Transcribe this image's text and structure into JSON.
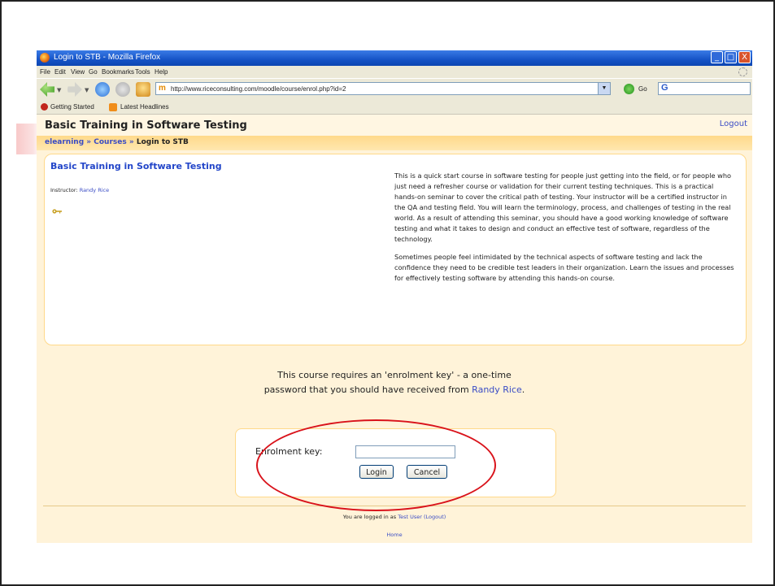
{
  "window": {
    "title": "Login to STB - Mozilla Firefox",
    "controls": {
      "minimize": "_",
      "maximize": "□",
      "close": "X"
    }
  },
  "menu": [
    "File",
    "Edit",
    "View",
    "Go",
    "Bookmarks",
    "Tools",
    "Help"
  ],
  "nav": {
    "url": "http://www.riceconsulting.com/moodle/course/enrol.php?id=2",
    "go_label": "Go",
    "search_glyph": "G"
  },
  "bookmarks": [
    "Getting Started",
    "Latest Headlines"
  ],
  "page": {
    "site_title": "Basic Training in Software Testing",
    "logout": "Logout",
    "breadcrumb": {
      "home": "elearning",
      "sep": "»",
      "courses": "Courses",
      "current": "Login to STB"
    }
  },
  "course": {
    "title": "Basic Training in Software Testing",
    "instructor_label": "Instructor:",
    "instructor_name": "Randy Rice",
    "summary_p1": "This is a quick start course in software testing for people just getting into the field, or for people who just need a refresher course or validation for their current testing techniques. This is a practical hands-on seminar to cover the critical path of testing. Your instructor will be a certified instructor in the QA and testing field. You will learn the terminology, process, and challenges of testing in the real world. As a result of attending this seminar, you should have a good working knowledge of software testing and what it takes to design and conduct an effective test of software, regardless of the technology.",
    "summary_p2": "Sometimes people feel intimidated by the technical aspects of software testing and lack the confidence they need to be credible test leaders in their organization. Learn the issues and processes for effectively testing software by attending this hands-on course."
  },
  "enrol": {
    "message_line1": "This course requires an 'enrolment key' - a one-time",
    "message_line2": "password that you should have received from",
    "teacher": "Randy Rice",
    "period": ".",
    "key_label": "Enrolment key:",
    "key_value": "",
    "login_button": "Login",
    "cancel_button": "Cancel"
  },
  "footer": {
    "logged_in_prefix": "You are logged in as",
    "user": "Test User",
    "logout": "(Logout)",
    "home": "Home"
  },
  "colors": {
    "page_bg": "#fff3d9",
    "link": "#3a4cc5",
    "annotation": "#d9131b"
  }
}
